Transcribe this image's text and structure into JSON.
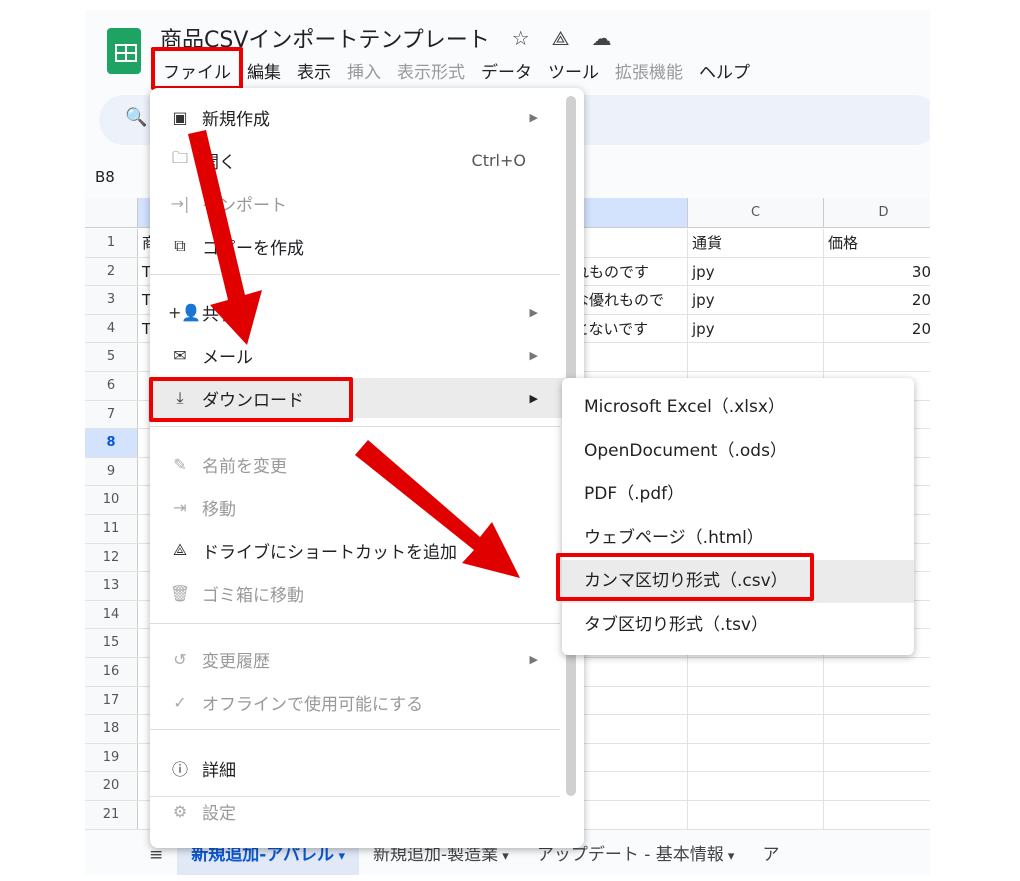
{
  "header": {
    "title": "商品CSVインポートテンプレート",
    "star_icon": "☆",
    "drive_icon": "⟁",
    "cloud_icon": "☁"
  },
  "menubar": [
    "ファイル",
    "編集",
    "表示",
    "挿入",
    "表示形式",
    "データ",
    "ツール",
    "拡張機能",
    "ヘルプ"
  ],
  "menubar_disabled": [
    false,
    false,
    false,
    true,
    true,
    false,
    false,
    true,
    false
  ],
  "toolbar": {
    "search_icon": "🔍"
  },
  "name_box": "B8",
  "columns": [
    "",
    "C",
    "D"
  ],
  "rows": [
    {
      "n": "1",
      "a": "商",
      "b": "",
      "c": "通貨",
      "d": "価格"
    },
    {
      "n": "2",
      "a": "T",
      "b": "れものです",
      "c": "jpy",
      "d": "30"
    },
    {
      "n": "3",
      "a": "T",
      "b": "な優れもので",
      "c": "jpy",
      "d": "20"
    },
    {
      "n": "4",
      "a": "T",
      "b": "とないです",
      "c": "jpy",
      "d": "20"
    },
    {
      "n": "5"
    },
    {
      "n": "6"
    },
    {
      "n": "7"
    },
    {
      "n": "8"
    },
    {
      "n": "9"
    },
    {
      "n": "10"
    },
    {
      "n": "11"
    },
    {
      "n": "12"
    },
    {
      "n": "13"
    },
    {
      "n": "14"
    },
    {
      "n": "15"
    },
    {
      "n": "16"
    },
    {
      "n": "17"
    },
    {
      "n": "18"
    },
    {
      "n": "19"
    },
    {
      "n": "20"
    },
    {
      "n": "21"
    }
  ],
  "file_menu": [
    {
      "label": "新規作成",
      "icon": "▣",
      "submenu": true
    },
    {
      "label": "開く",
      "icon": "🗀",
      "shortcut": "Ctrl+O"
    },
    {
      "label": "インポート",
      "icon": "→|",
      "disabled": true
    },
    {
      "label": "コピーを作成",
      "icon": "⧉"
    },
    {
      "label": "共有",
      "icon": "+👤",
      "submenu": true
    },
    {
      "label": "メール",
      "icon": "✉",
      "submenu": true
    },
    {
      "label": "ダウンロード",
      "icon": "⤓",
      "submenu": true,
      "highlight": true
    },
    {
      "label": "名前を変更",
      "icon": "✎",
      "disabled": true
    },
    {
      "label": "移動",
      "icon": "⇥",
      "disabled": true
    },
    {
      "label": "ドライブにショートカットを追加",
      "icon": "⟁"
    },
    {
      "label": "ゴミ箱に移動",
      "icon": "🗑",
      "disabled": true
    },
    {
      "label": "変更履歴",
      "icon": "↺",
      "submenu": true,
      "disabled": true
    },
    {
      "label": "オフラインで使用可能にする",
      "icon": "✓",
      "disabled": true
    },
    {
      "label": "詳細",
      "icon": "ⓘ"
    },
    {
      "label": "設定",
      "icon": "⚙",
      "disabled": true
    }
  ],
  "download_submenu": [
    "Microsoft Excel（.xlsx）",
    "OpenDocument（.ods）",
    "PDF（.pdf）",
    "ウェブページ（.html）",
    "カンマ区切り形式（.csv）",
    "タブ区切り形式（.tsv）"
  ],
  "sheet_tabs": [
    "新規追加-アパレル",
    "新規追加-製造業",
    "アップデート - 基本情報",
    "ア"
  ],
  "sheets_menu_icon": "≡",
  "colors": {
    "annotation_red": "#e00000",
    "selected_tab": "#0b57d0"
  }
}
